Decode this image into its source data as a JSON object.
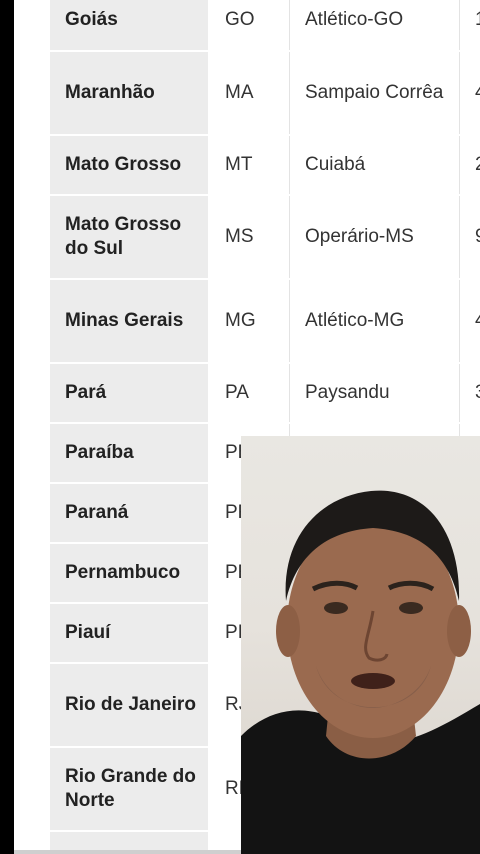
{
  "table": {
    "rows": [
      {
        "state": "Goiás",
        "uf": "GO",
        "club": "Atlético-GO",
        "num": "1"
      },
      {
        "state": "Maranhão",
        "uf": "MA",
        "club": "Sampaio Corrêa",
        "num": "4"
      },
      {
        "state": "Mato Grosso",
        "uf": "MT",
        "club": "Cuiabá",
        "num": "2"
      },
      {
        "state": "Mato Grosso do Sul",
        "uf": "MS",
        "club": "Operário-MS",
        "num": "9"
      },
      {
        "state": "Minas Gerais",
        "uf": "MG",
        "club": "Atlético-MG",
        "num": "4"
      },
      {
        "state": "Pará",
        "uf": "PA",
        "club": "Paysandu",
        "num": "3"
      },
      {
        "state": "Paraíba",
        "uf": "PB",
        "club": "",
        "num": ""
      },
      {
        "state": "Paraná",
        "uf": "PR",
        "club": "",
        "num": ""
      },
      {
        "state": "Pernambuco",
        "uf": "PE",
        "club": "",
        "num": ""
      },
      {
        "state": "Piauí",
        "uf": "PI",
        "club": "",
        "num": ""
      },
      {
        "state": "Rio de Janeiro",
        "uf": "RJ",
        "club": "",
        "num": ""
      },
      {
        "state": "Rio Grande do Norte",
        "uf": "RN",
        "club": "",
        "num": ""
      }
    ]
  },
  "video_overlay": {
    "description_icon": "person-facecam"
  }
}
